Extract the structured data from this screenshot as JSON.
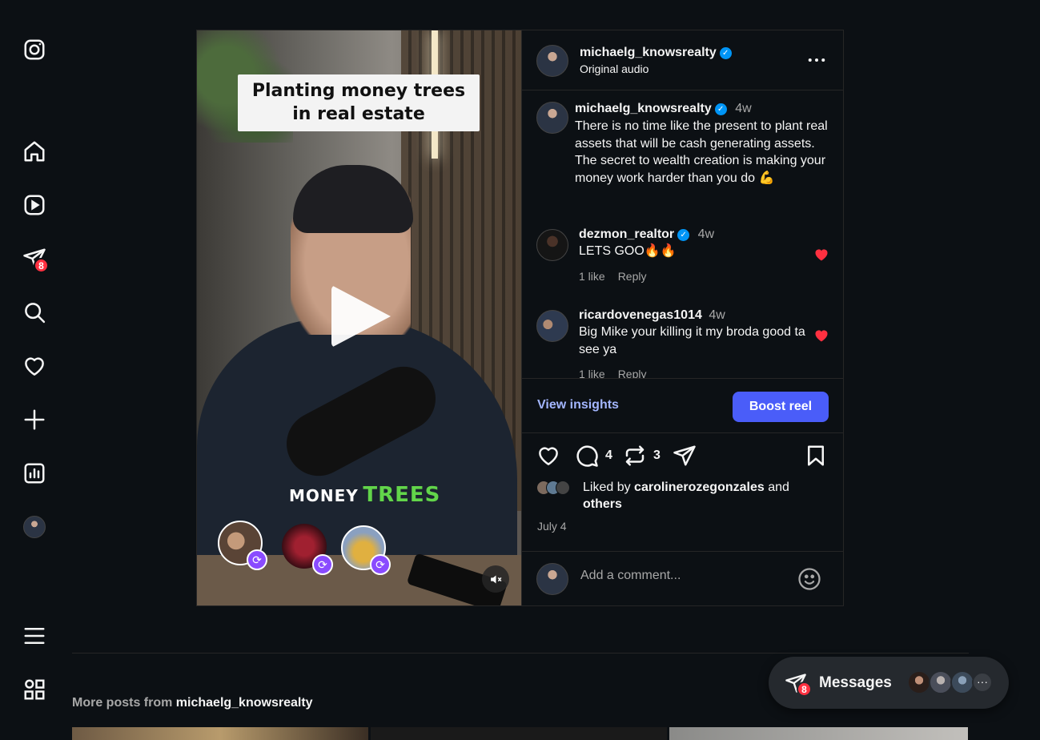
{
  "app": {
    "name": "Instagram"
  },
  "sidebar": {
    "items": [
      {
        "name": "instagram-logo",
        "label": "Instagram"
      },
      {
        "name": "home",
        "label": "Home"
      },
      {
        "name": "reels",
        "label": "Reels"
      },
      {
        "name": "messages",
        "label": "Messages",
        "badge": "8"
      },
      {
        "name": "search",
        "label": "Search"
      },
      {
        "name": "notifications",
        "label": "Notifications"
      },
      {
        "name": "create",
        "label": "Create"
      },
      {
        "name": "dashboard",
        "label": "Dashboard"
      },
      {
        "name": "profile",
        "label": "Profile"
      },
      {
        "name": "more",
        "label": "More"
      },
      {
        "name": "also-from-meta",
        "label": "Also from Meta"
      }
    ]
  },
  "post": {
    "video": {
      "title_card": "Planting money trees\nin real estate",
      "caption_money": "MONEY",
      "caption_trees": "TREES"
    },
    "header": {
      "username": "michaelg_knowsrealty",
      "audio": "Original audio"
    },
    "caption": {
      "username": "michaelg_knowsrealty",
      "time": "4w",
      "text": "There is no time like the present to plant real assets that will be cash generating assets. The secret to wealth creation is making your money work harder than you do 💪"
    },
    "comments": [
      {
        "username": "dezmon_realtor",
        "verified": true,
        "time": "4w",
        "text": "LETS GOO🔥🔥",
        "likes": "1 like",
        "reply": "Reply"
      },
      {
        "username": "ricardovenegas1014",
        "verified": false,
        "time": "4w",
        "text": "Big Mike your killing it my broda good ta see ya",
        "likes": "1 like",
        "reply": "Reply"
      }
    ],
    "insights": {
      "view_label": "View insights",
      "boost_label": "Boost reel"
    },
    "actions": {
      "comment_count": "4",
      "repost_count": "3"
    },
    "liked_by": {
      "prefix": "Liked by ",
      "user": "carolinerozegonzales",
      "and": " and",
      "others": "others"
    },
    "date": "July 4",
    "add_comment": {
      "placeholder": "Add a comment..."
    }
  },
  "more_posts": {
    "prefix": "More posts from ",
    "username": "michaelg_knowsrealty"
  },
  "messages_pill": {
    "label": "Messages",
    "badge": "8",
    "more": "···"
  },
  "colors": {
    "background": "#0c1014",
    "accent": "#4a5df9",
    "link": "#a3b6ff",
    "like_red": "#ff3040",
    "verified_blue": "#0095f6"
  }
}
